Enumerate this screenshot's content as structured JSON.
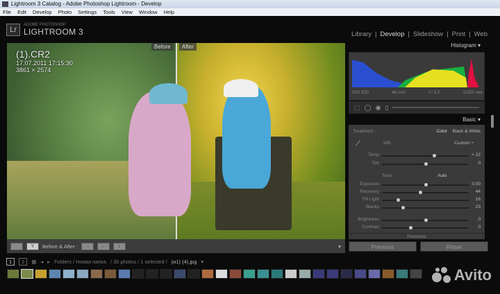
{
  "window": {
    "title": "Lightroom 3 Catalog - Adobe Photoshop Lightroom - Develop"
  },
  "menu": [
    "File",
    "Edit",
    "Develop",
    "Photo",
    "Settings",
    "Tools",
    "View",
    "Window",
    "Help"
  ],
  "logo": {
    "badge": "Lr",
    "small": "ADOBE PHOTOSHOP",
    "big": "LIGHTROOM 3"
  },
  "modules": [
    {
      "label": "Library"
    },
    {
      "label": "Develop",
      "active": true
    },
    {
      "label": "Slideshow"
    },
    {
      "label": "Print"
    },
    {
      "label": "Web"
    }
  ],
  "photo": {
    "name": "(1).CR2",
    "date": "17.07.2011 17:15:30",
    "size": "3861 × 2574",
    "before_label": "Before",
    "after_label": "After"
  },
  "toolbar": {
    "mode_label": "Before & After :"
  },
  "histogram": {
    "title": "Histogram",
    "iso": "ISO 320",
    "focal": "46 mm",
    "aperture": "f / 3.2",
    "shutter": "1/250 sec"
  },
  "basic": {
    "title": "Basic",
    "treatment_label": "Treatment :",
    "color": "Color",
    "bw": "Black & White",
    "wb_label": "WB :",
    "wb_value": "Custom ÷",
    "tone_label": "Tone",
    "auto": "Auto",
    "presence": "Presence",
    "sliders": [
      {
        "label": "Temp",
        "value": "+ 22",
        "pos": 0.6
      },
      {
        "label": "Tint",
        "value": "0",
        "pos": 0.5
      },
      {
        "label": "Exposure",
        "value": "0.00",
        "pos": 0.5
      },
      {
        "label": "Recovery",
        "value": "44",
        "pos": 0.44
      },
      {
        "label": "Fill Light",
        "value": "16",
        "pos": 0.18
      },
      {
        "label": "Blacks",
        "value": "23",
        "pos": 0.24
      },
      {
        "label": "Brightness",
        "value": "0",
        "pos": 0.5
      },
      {
        "label": "Contrast",
        "value": "0",
        "pos": 0.33
      }
    ]
  },
  "buttons": {
    "previous": "Previous",
    "reset": "Reset"
  },
  "filmstrip": {
    "path": "Folders / Новая папка",
    "count": "/ 30 photos / 1 selected /",
    "file": "(и1) (4).jpg",
    "page1": "1",
    "page2": "2",
    "thumbs": [
      "#6b7a3a",
      "#7a8a4a",
      "#c8a030",
      "#5c86b0",
      "#8eb0cc",
      "#8aa8c0",
      "#8a6a4a",
      "#7a5a3a",
      "#5a7ab0",
      "#222",
      "#222",
      "#222",
      "#3a4a6a",
      "#222",
      "#b06a40",
      "#ddd",
      "#8a4a3a",
      "#3aa090",
      "#3a9090",
      "#2a7a7a",
      "#ccc",
      "#9aa",
      "#3a3a7a",
      "#3a3a7a",
      "#2a2a4a",
      "#4a4a8a",
      "#6a6aaa",
      "#8a5a2a",
      "#3a7a7a",
      "#444"
    ]
  },
  "watermark": "Avito"
}
